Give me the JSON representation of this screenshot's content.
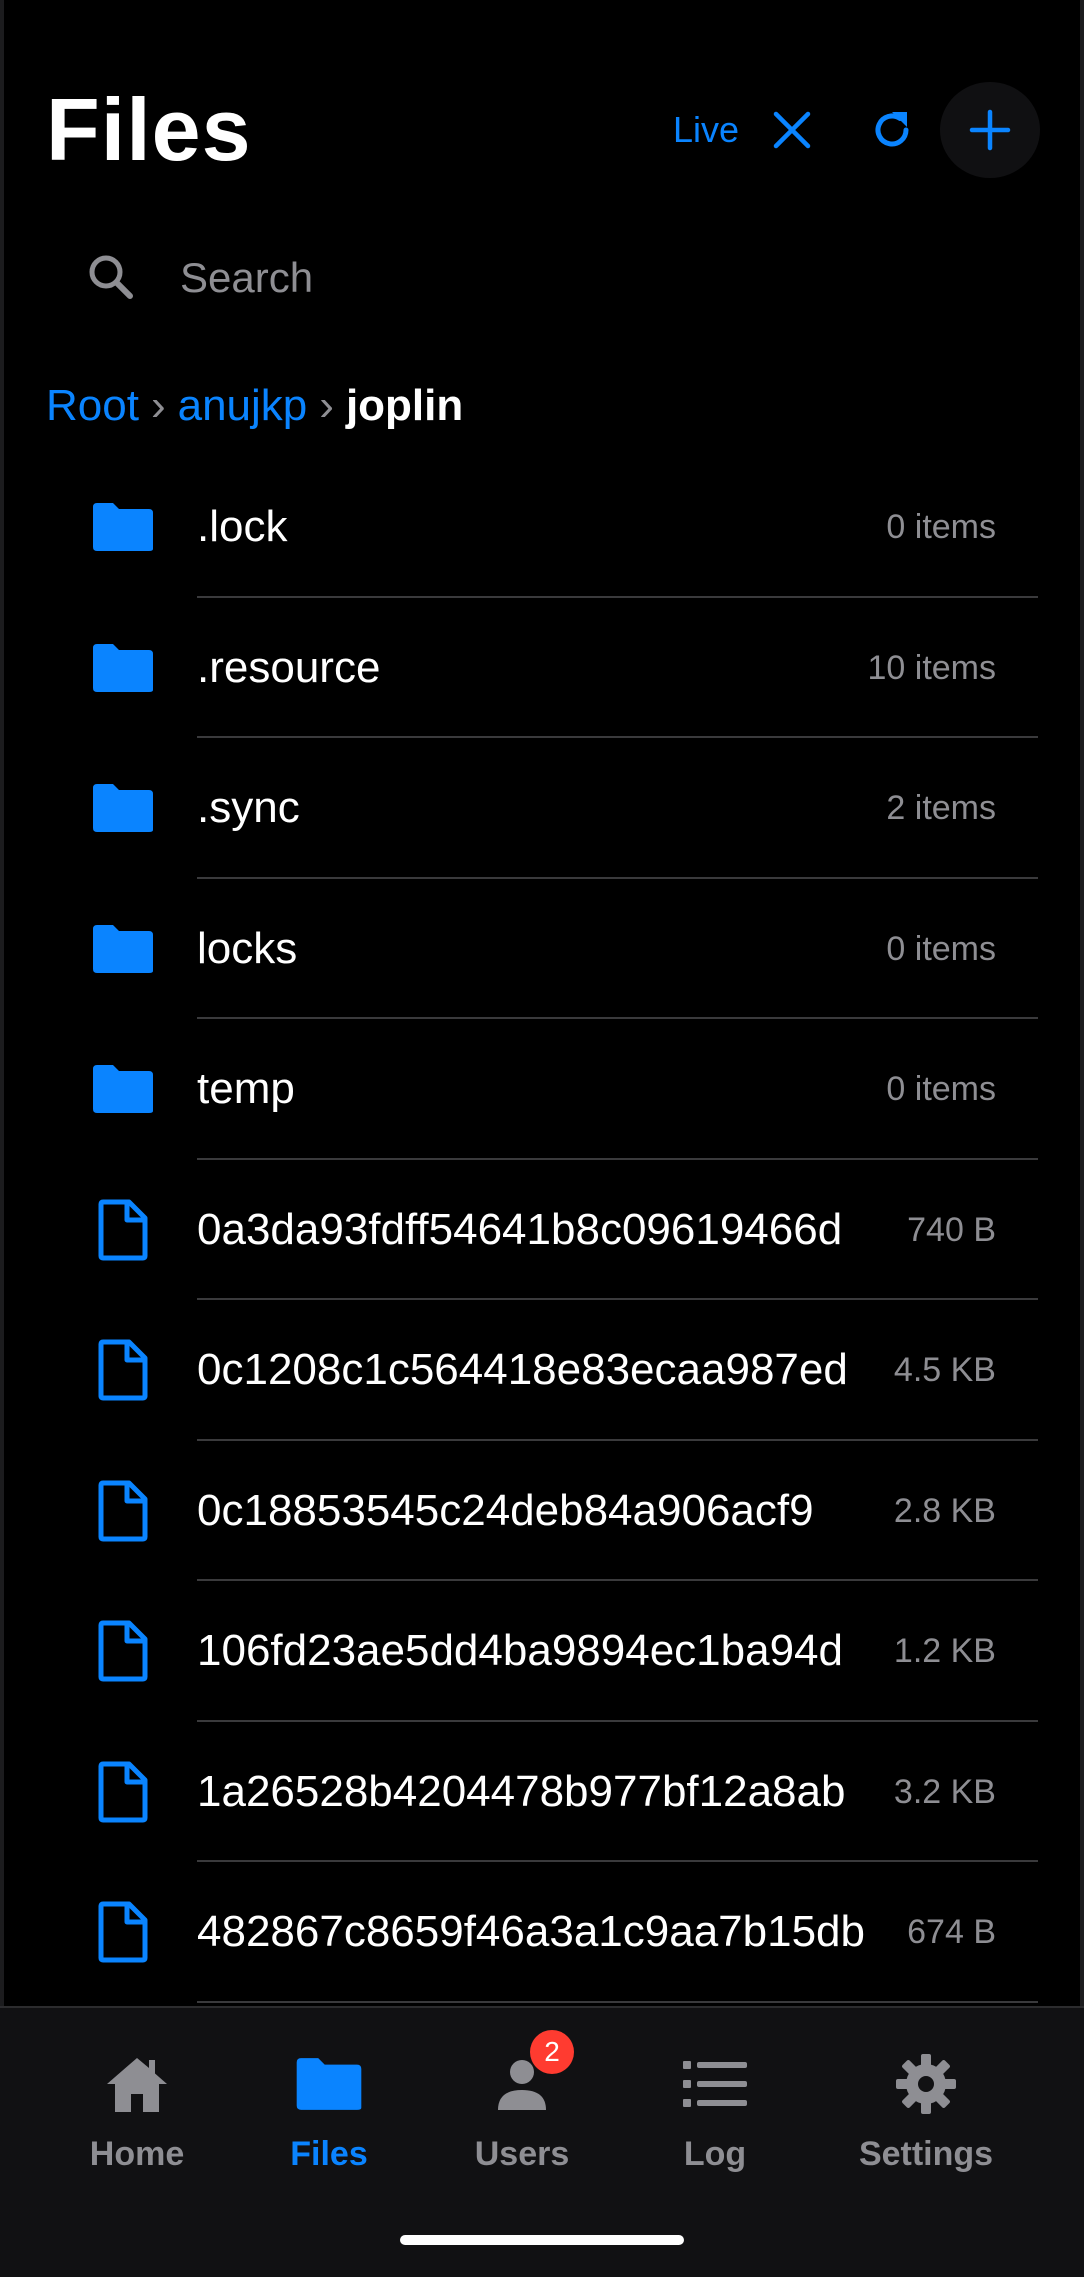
{
  "header": {
    "title": "Files",
    "live_label": "Live",
    "close_icon": "close-icon",
    "refresh_icon": "refresh-icon",
    "add_icon": "plus-icon"
  },
  "search": {
    "placeholder": "Search",
    "value": ""
  },
  "breadcrumb": {
    "items": [
      "Root",
      "anujkp"
    ],
    "current": "joplin",
    "separator": "›"
  },
  "files": [
    {
      "type": "folder",
      "name": ".lock",
      "meta": "0 items"
    },
    {
      "type": "folder",
      "name": ".resource",
      "meta": "10 items"
    },
    {
      "type": "folder",
      "name": ".sync",
      "meta": "2 items"
    },
    {
      "type": "folder",
      "name": "locks",
      "meta": "0 items"
    },
    {
      "type": "folder",
      "name": "temp",
      "meta": "0 items"
    },
    {
      "type": "file",
      "name": "0a3da93fdff54641b8c09619466d",
      "meta": "740 B"
    },
    {
      "type": "file",
      "name": "0c1208c1c564418e83ecaa987ed",
      "meta": "4.5 KB"
    },
    {
      "type": "file",
      "name": "0c18853545c24deb84a906acf9",
      "meta": "2.8 KB"
    },
    {
      "type": "file",
      "name": "106fd23ae5dd4ba9894ec1ba94d",
      "meta": "1.2 KB"
    },
    {
      "type": "file",
      "name": "1a26528b4204478b977bf12a8ab",
      "meta": "3.2 KB"
    },
    {
      "type": "file",
      "name": "482867c8659f46a3a1c9aa7b15db",
      "meta": "674 B"
    }
  ],
  "tabs": [
    {
      "label": "Home",
      "icon": "home-icon",
      "active": false
    },
    {
      "label": "Files",
      "icon": "folder-icon",
      "active": true
    },
    {
      "label": "Users",
      "icon": "user-icon",
      "active": false,
      "badge": "2"
    },
    {
      "label": "Log",
      "icon": "list-icon",
      "active": false
    },
    {
      "label": "Settings",
      "icon": "gear-icon",
      "active": false
    }
  ],
  "colors": {
    "accent": "#0a84ff",
    "background": "#000000",
    "secondary_text": "#8e8e93",
    "badge": "#ff3b30"
  }
}
